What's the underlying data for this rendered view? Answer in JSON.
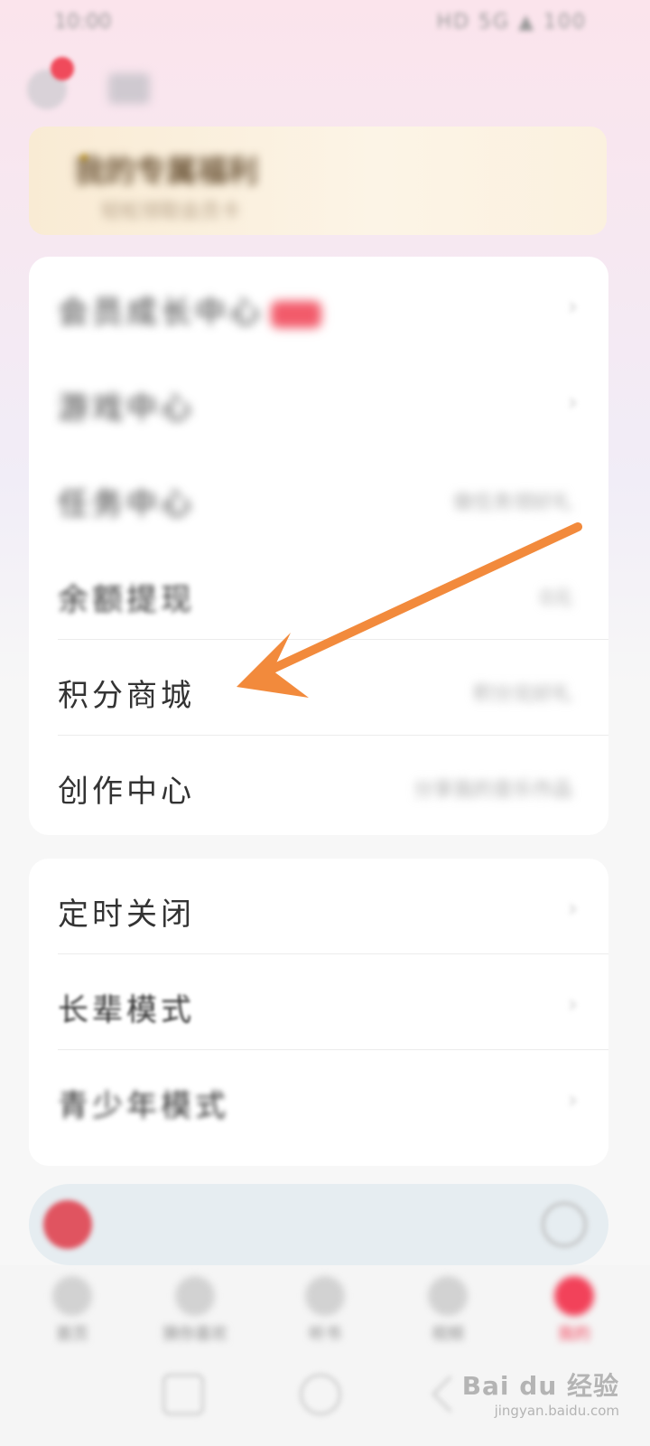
{
  "status_bar": {
    "time": "10:00",
    "icons": "HD 5G ▲ 100"
  },
  "header": {
    "username": ""
  },
  "vip_banner": {
    "title": "我的专属福利",
    "subtitle": "轻松领取会员卡"
  },
  "menu_card_1": {
    "items": [
      {
        "label": "会员成长中心",
        "value": "",
        "badge": ""
      },
      {
        "label": "游戏中心",
        "value": ""
      },
      {
        "label": "任务中心",
        "value": "做任务领好礼"
      },
      {
        "label": "余额提现",
        "value": "0元"
      },
      {
        "label": "积分商城",
        "value": "积分兑好礼"
      },
      {
        "label": "创作中心",
        "value": "分享我的音乐作品"
      }
    ]
  },
  "menu_card_2": {
    "items": [
      {
        "label": "定时关闭"
      },
      {
        "label": "长辈模式"
      },
      {
        "label": "青少年模式"
      }
    ]
  },
  "mini_player": {
    "song": "",
    "lyric": ""
  },
  "tabbar": {
    "tabs": [
      {
        "label": "首页"
      },
      {
        "label": "猜你喜欢"
      },
      {
        "label": "听书"
      },
      {
        "label": "视频"
      },
      {
        "label": "我的"
      }
    ]
  },
  "watermark": {
    "main": "Bai du 经验",
    "sub": "jingyan.baidu.com"
  },
  "colors": {
    "accent": "#f2425a",
    "arrow": "#f28a3c"
  },
  "chevron": "›"
}
